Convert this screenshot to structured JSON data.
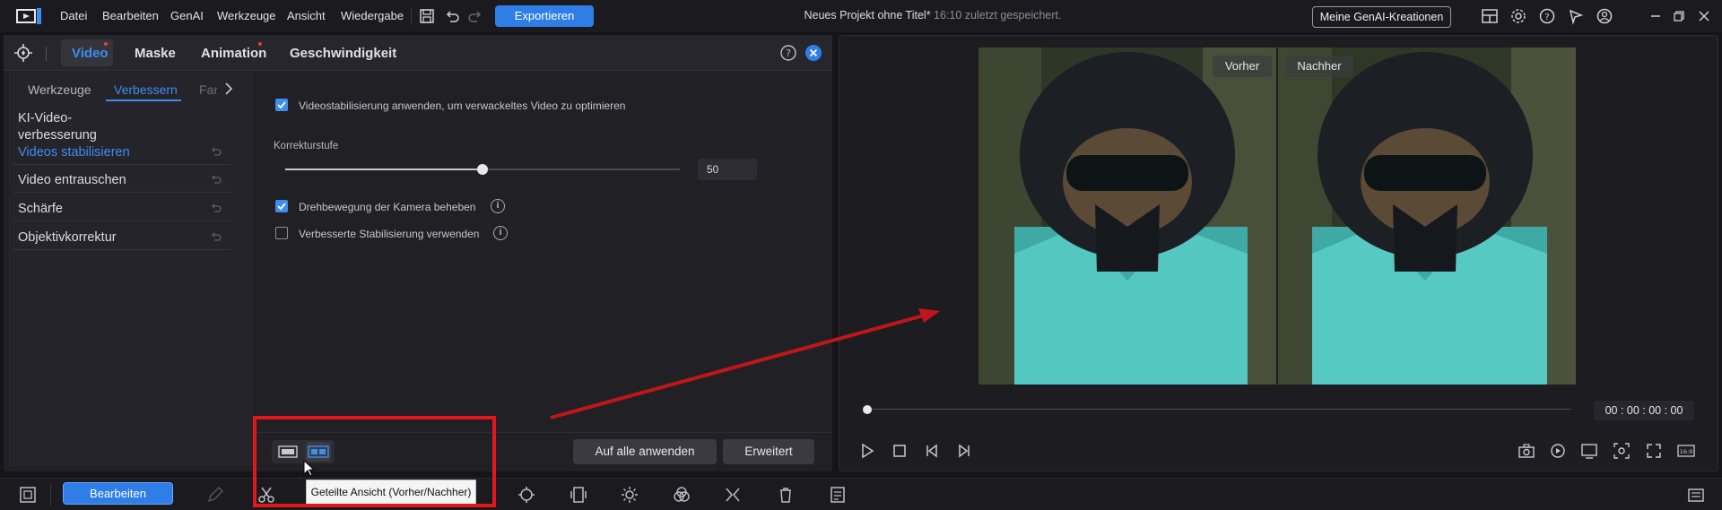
{
  "menu": [
    "Datei",
    "Bearbeiten",
    "GenAI",
    "Werkzeuge",
    "Ansicht",
    "Wiedergabe"
  ],
  "export_label": "Exportieren",
  "project": {
    "name": "Neues Projekt ohne Titel*",
    "saved": "16:10 zuletzt gespeichert."
  },
  "genai_button": "Meine GenAI-Kreationen",
  "tabs": [
    "Video",
    "Maske",
    "Animation",
    "Geschwindigkeit"
  ],
  "subtabs": [
    "Werkzeuge",
    "Verbessern",
    "Far"
  ],
  "sidebar": {
    "group_title": "KI-Video-verbesserung",
    "items": [
      "Videos stabilisieren",
      "Video entrauschen",
      "Schärfe",
      "Objektivkorrektur"
    ]
  },
  "content": {
    "stabilize_label": "Videostabilisierung anwenden, um verwackeltes Video zu optimieren",
    "stabilize_checked": true,
    "correction_label": "Korrekturstufe",
    "correction_value": "50",
    "correction_fraction": 0.5,
    "rotation_label": "Drehbewegung der Kamera beheben",
    "rotation_checked": true,
    "enhanced_label": "Verbesserte Stabilisierung verwenden",
    "enhanced_checked": false
  },
  "buttons": {
    "apply_all": "Auf alle anwenden",
    "advanced": "Erweitert"
  },
  "preview": {
    "before": "Vorher",
    "after": "Nachher",
    "timecode": "00 : 00 : 00 : 00"
  },
  "toolbar": {
    "edit": "Bearbeiten"
  },
  "tooltip": "Geteilte Ansicht (Vorher/Nachher)",
  "colors": {
    "accent": "#2f7ee8",
    "highlight": "#e3161b"
  }
}
